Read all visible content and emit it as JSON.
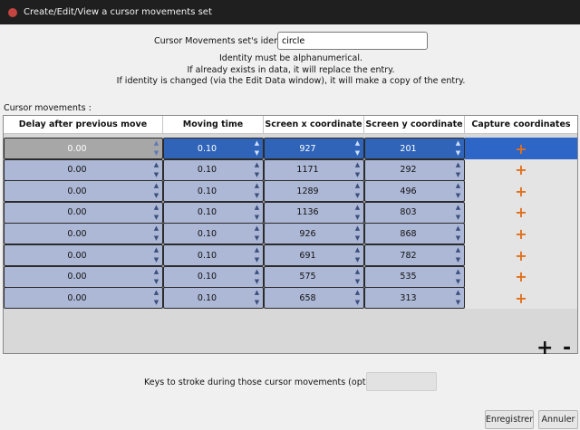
{
  "window": {
    "title": "Create/Edit/View a cursor movements set"
  },
  "identity": {
    "label": "Cursor Movements set's identity",
    "value": "circle"
  },
  "help_lines": [
    "Identity must be alphanumerical.",
    "If already exists in data, it will replace the entry.",
    "If identity is changed (via the Edit Data window), it will make a copy of the entry."
  ],
  "movements": {
    "label": "Cursor movements :",
    "columns": [
      "Delay after previous move",
      "Moving time",
      "Screen x coordinate",
      "Screen y coordinate",
      "Capture coordinates"
    ],
    "rows": [
      {
        "delay": "0.00",
        "moving_time": "0.10",
        "x": "927",
        "y": "201"
      },
      {
        "delay": "0.00",
        "moving_time": "0.10",
        "x": "1171",
        "y": "292"
      },
      {
        "delay": "0.00",
        "moving_time": "0.10",
        "x": "1289",
        "y": "496"
      },
      {
        "delay": "0.00",
        "moving_time": "0.10",
        "x": "1136",
        "y": "803"
      },
      {
        "delay": "0.00",
        "moving_time": "0.10",
        "x": "926",
        "y": "868"
      },
      {
        "delay": "0.00",
        "moving_time": "0.10",
        "x": "691",
        "y": "782"
      },
      {
        "delay": "0.00",
        "moving_time": "0.10",
        "x": "575",
        "y": "535"
      },
      {
        "delay": "0.00",
        "moving_time": "0.10",
        "x": "658",
        "y": "313"
      }
    ],
    "capture_symbol": "+",
    "add_symbol": "+",
    "remove_symbol": "-"
  },
  "keys": {
    "label": "Keys to stroke during those cursor movements (optional) :",
    "value": ""
  },
  "buttons": {
    "save": "Enregistrer",
    "cancel": "Annuler"
  },
  "colors": {
    "accent_selected": "#2f64b8",
    "capture_plus": "#e0701c",
    "cell_fill": "#adb8d6"
  }
}
